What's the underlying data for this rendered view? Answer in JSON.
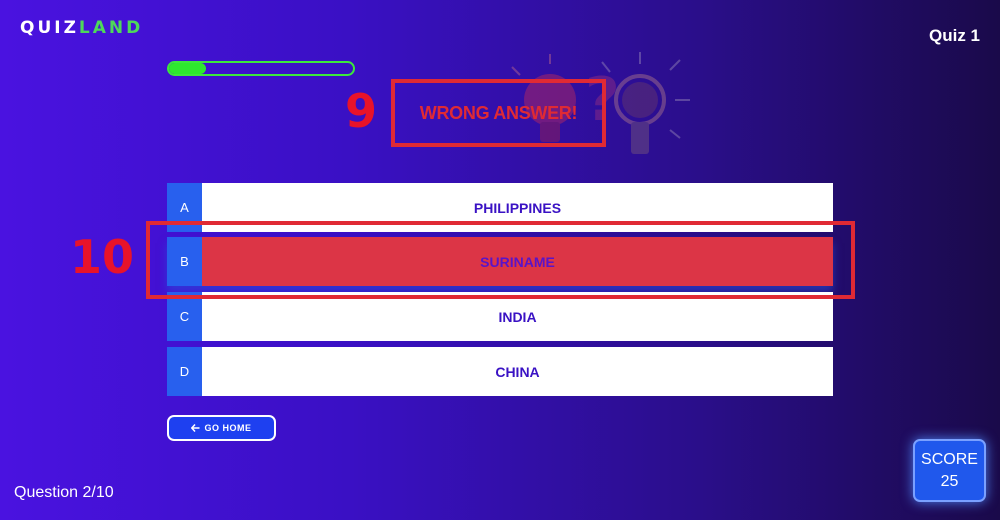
{
  "app": {
    "logo_part1": "QUIZ",
    "logo_part2": "LAND",
    "quiz_title": "Quiz 1"
  },
  "progress": {
    "fraction": 0.2
  },
  "feedback": {
    "text": "WRONG ANSWER!",
    "marker": "9"
  },
  "answers": [
    {
      "letter": "A",
      "text": "PHILIPPINES",
      "state": "normal"
    },
    {
      "letter": "B",
      "text": "SURINAME",
      "state": "wrong"
    },
    {
      "letter": "C",
      "text": "INDIA",
      "state": "normal"
    },
    {
      "letter": "D",
      "text": "CHINA",
      "state": "normal"
    }
  ],
  "highlight_marker": "10",
  "go_home": {
    "icon": "arrow-left-icon",
    "label": "GO HOME"
  },
  "footer": {
    "question": "Question 2/10"
  },
  "score": {
    "label": "SCORE",
    "value": "25"
  },
  "colors": {
    "accent_green": "#2ee82e",
    "wrong_red": "#dc3546",
    "annotation_red": "#e02a34",
    "button_blue": "#1e40f0"
  }
}
